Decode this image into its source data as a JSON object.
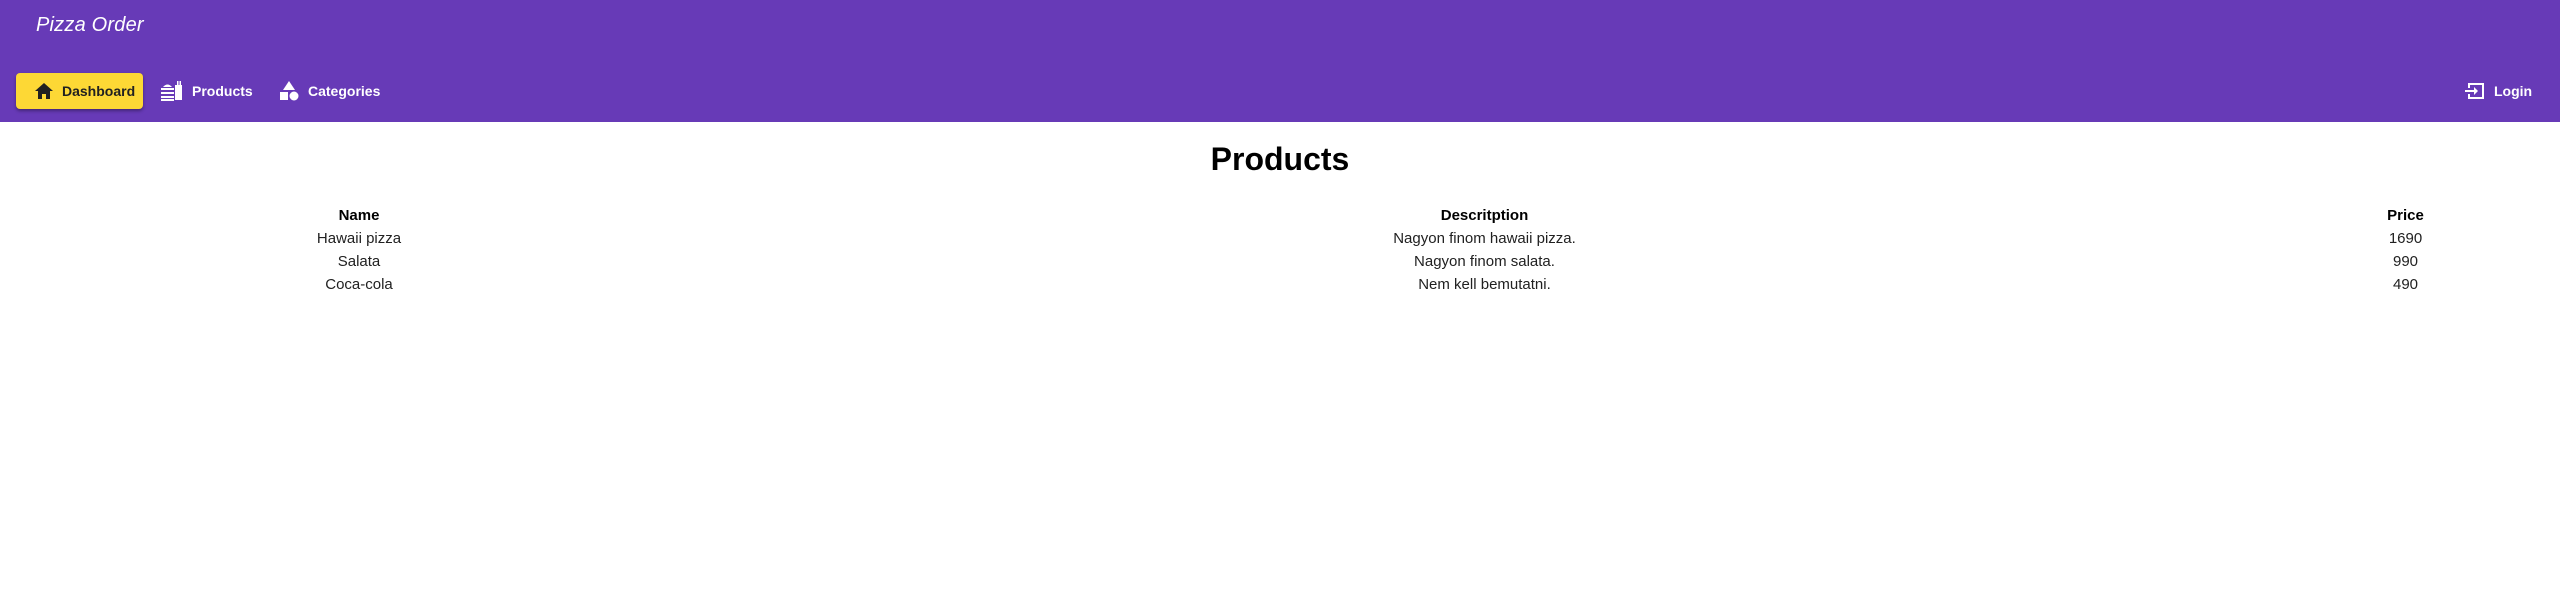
{
  "app": {
    "title": "Pizza Order"
  },
  "toolbar": {
    "items": [
      {
        "label": "Dashboard",
        "icon": "home-icon",
        "active": true
      },
      {
        "label": "Products",
        "icon": "menu-book-icon",
        "active": false
      },
      {
        "label": "Categories",
        "icon": "category-shapes-icon",
        "active": false
      }
    ],
    "login_label": "Login",
    "login_icon": "login-icon"
  },
  "page": {
    "title": "Products"
  },
  "table": {
    "headers": [
      "Name",
      "Descritption",
      "Price"
    ],
    "rows": [
      [
        "Hawaii pizza",
        "Nagyon finom hawaii pizza.",
        "1690"
      ],
      [
        "Salata",
        "Nagyon finom salata.",
        "990"
      ],
      [
        "Coca-cola",
        "Nem kell bemutatni.",
        "490"
      ]
    ]
  },
  "colors": {
    "appbar": "#673ab7",
    "active_button": "#fdd835",
    "appbar_text": "#ffffff"
  }
}
